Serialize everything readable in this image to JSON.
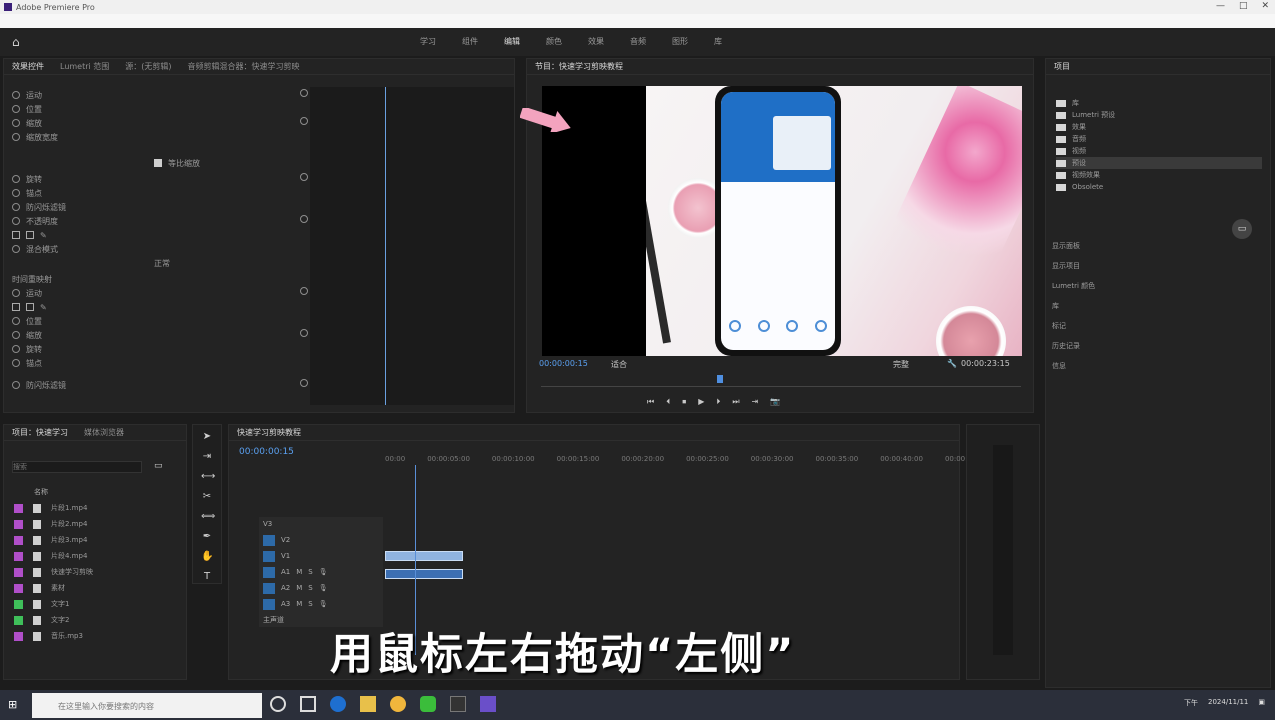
{
  "workspace_tabs": [
    "学习",
    "组件",
    "编辑",
    "颜色",
    "效果",
    "音频",
    "图形",
    "库"
  ],
  "effects_panel": {
    "tabs": [
      "效果控件",
      "Lumetri 范围",
      "源：(无剪辑)",
      "音频剪辑混合器：快速学习剪映"
    ],
    "rows": [
      "运动",
      "位置",
      "缩放",
      "缩放宽度",
      "等比缩放",
      "旋转",
      "锚点",
      "防闪烁滤镜",
      "不透明度",
      "混合模式",
      "时间重映射",
      "运动",
      "位置",
      "缩放",
      "旋转",
      "锚点",
      "防闪烁滤镜"
    ],
    "uniform_scale": "等比缩放",
    "blend_mode": "正常"
  },
  "program_monitor": {
    "title": "节目：快速学习剪映教程",
    "timecode_left": "00:00:00:15",
    "fit": "适合",
    "quality": "完整",
    "timecode_right": "00:00:23:15",
    "transport": [
      "⏮",
      "⏴",
      "⏹",
      "▶",
      "⏵",
      "⏭",
      "⇥",
      "📷"
    ]
  },
  "project_panel": {
    "title": "项目",
    "items": [
      "库",
      "Lumetri 预设",
      "效果",
      "音频",
      "视频",
      "预设",
      "视频效果",
      "Obsolete"
    ],
    "menu": [
      "显示面板",
      "显示项目",
      "Lumetri 颜色",
      "库",
      "标记",
      "历史记录",
      "信息"
    ]
  },
  "media_panel": {
    "tabs": [
      "项目：快速学习",
      "媒体浏览器"
    ],
    "search_placeholder": "搜索",
    "column_name": "名称",
    "items": [
      "片段1.mp4",
      "片段2.mp4",
      "片段3.mp4",
      "片段4.mp4",
      "快速学习剪映",
      "素材",
      "文字1",
      "文字2",
      "音乐.mp3"
    ]
  },
  "timeline": {
    "title": "快速学习剪映教程",
    "timecode": "00:00:00:15",
    "ruler": [
      "00:00",
      "00:00:05:00",
      "00:00:10:00",
      "00:00:15:00",
      "00:00:20:00",
      "00:00:25:00",
      "00:00:30:00",
      "00:00:35:00",
      "00:00:40:00",
      "00:00:45:00"
    ],
    "tracks": [
      "V3",
      "V2",
      "V1",
      "A1",
      "A2",
      "A3",
      "主声道"
    ]
  },
  "subtitle": "用鼠标左右拖动“左侧”",
  "taskbar": {
    "search_placeholder": "在这里输入你要搜索的内容",
    "time": "下午",
    "date": "2024/11/11"
  }
}
